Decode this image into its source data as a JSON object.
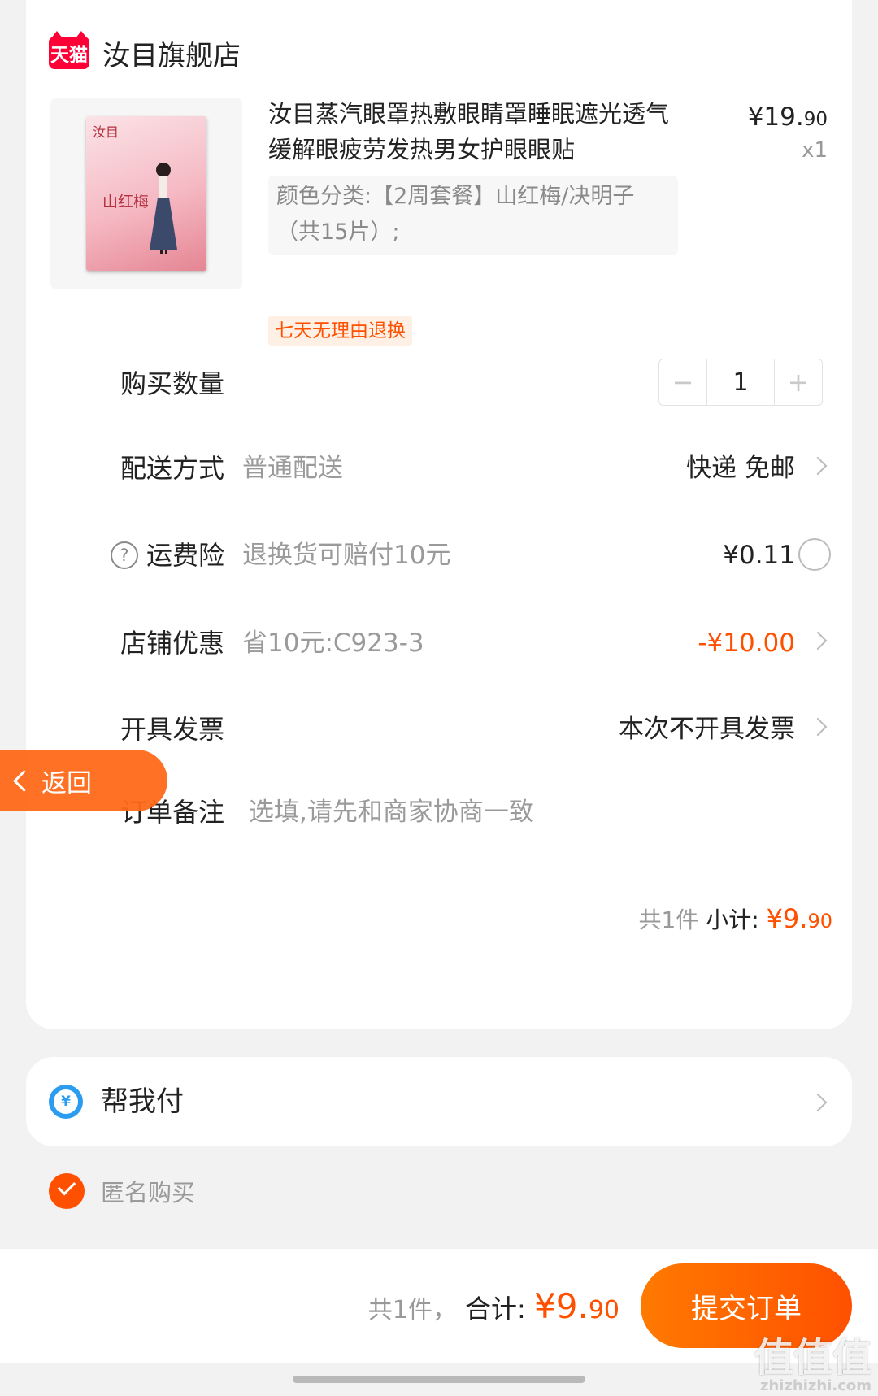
{
  "shop": {
    "badge": "天猫",
    "name": "汝目旗舰店"
  },
  "product": {
    "image_brand": "汝目",
    "image_text": "山红梅",
    "title": "汝目蒸汽眼罩热敷眼睛罩睡眠遮光透气缓解眼疲劳发热男女护眼眼贴",
    "price_main": "¥19.",
    "price_decimal": "90",
    "quantity": "x1",
    "sku": "颜色分类:【2周套餐】山红梅/决明子（共15片）;",
    "tag": "七天无理由退换"
  },
  "rows": {
    "quantity": {
      "label": "购买数量",
      "minus": "−",
      "value": "1",
      "plus": "+"
    },
    "delivery": {
      "label": "配送方式",
      "sub": "普通配送",
      "value": "快递 免邮"
    },
    "insurance": {
      "help": "?",
      "label": "运费险",
      "sub": "退换货可赔付10元",
      "value": "¥0.11"
    },
    "coupon": {
      "label": "店铺优惠",
      "sub": "省10元:C923-3",
      "value": "-¥10.00"
    },
    "invoice": {
      "label": "开具发票",
      "value": "本次不开具发票"
    },
    "note": {
      "label": "订单备注",
      "placeholder": "选填,请先和商家协商一致"
    }
  },
  "subtotal": {
    "count": "共1件",
    "label": "小计:",
    "amount_main": "¥9.",
    "amount_decimal": "90"
  },
  "help_pay": {
    "icon_glyph": "¥",
    "label": "帮我付"
  },
  "anonymous": {
    "label": "匿名购买",
    "checked": true
  },
  "footer": {
    "count": "共1件，",
    "label": "合计:",
    "amount_main": "¥9.",
    "amount_decimal": "90",
    "submit_label": "提交订单"
  },
  "back": {
    "label": "返回"
  },
  "watermark": {
    "text": "值值值",
    "sub": "zhizhizhi.com"
  },
  "colors": {
    "accent": "#ff5000",
    "tmall": "#ff0036",
    "pay": "#2c9cf0"
  }
}
